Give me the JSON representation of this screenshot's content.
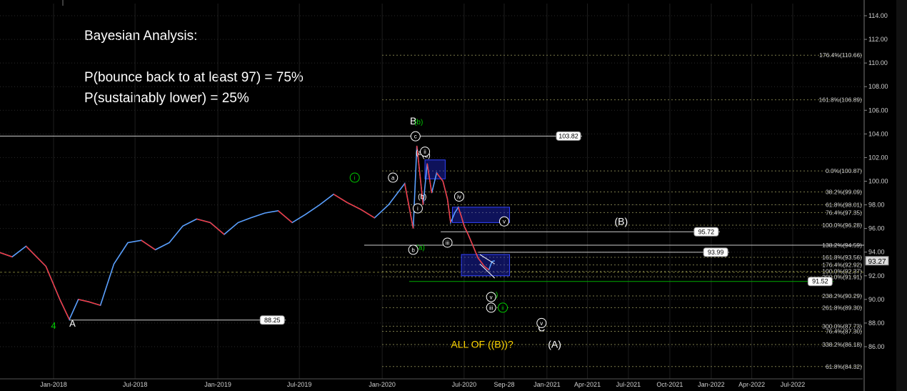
{
  "annotations": {
    "title": "Bayesian Analysis:",
    "prob_bounce": "P(bounce back to at least 97) = 75%",
    "prob_lower": "P(sustainably lower) = 25%"
  },
  "chart_data": {
    "type": "line",
    "title": "",
    "xlabel": "",
    "ylabel": "",
    "ylim": [
      83.5,
      115
    ],
    "grid": true,
    "x_ticks": [
      "Jan-2018",
      "Jul-2018",
      "Jan-2019",
      "Jul-2019",
      "Jan-2020",
      "Jul-2020",
      "Sep-28",
      "Jan-2021",
      "Apr-2021",
      "Jul-2021",
      "Oct-2021",
      "Jan-2022",
      "Apr-2022",
      "Jul-2022"
    ],
    "y_ticks": [
      86.0,
      88.0,
      90.0,
      92.0,
      94.0,
      96.0,
      98.0,
      100.0,
      102.0,
      104.0,
      106.0,
      108.0,
      110.0,
      112.0,
      114.0
    ],
    "last_price": 93.27,
    "price_path": [
      [
        "2017-09-01",
        94.0
      ],
      [
        "2017-10-01",
        93.6
      ],
      [
        "2017-11-01",
        94.5
      ],
      [
        "2017-12-15",
        92.8
      ],
      [
        "2018-01-15",
        90.0
      ],
      [
        "2018-02-05",
        88.3
      ],
      [
        "2018-02-25",
        90.0
      ],
      [
        "2018-03-20",
        89.8
      ],
      [
        "2018-04-15",
        89.5
      ],
      [
        "2018-05-15",
        93.0
      ],
      [
        "2018-06-15",
        94.8
      ],
      [
        "2018-07-15",
        95.0
      ],
      [
        "2018-08-15",
        94.2
      ],
      [
        "2018-09-15",
        94.8
      ],
      [
        "2018-10-15",
        96.2
      ],
      [
        "2018-11-15",
        96.8
      ],
      [
        "2018-12-15",
        96.5
      ],
      [
        "2019-01-15",
        95.5
      ],
      [
        "2019-02-15",
        96.5
      ],
      [
        "2019-03-15",
        96.9
      ],
      [
        "2019-04-15",
        97.3
      ],
      [
        "2019-05-15",
        97.5
      ],
      [
        "2019-06-15",
        96.5
      ],
      [
        "2019-07-15",
        97.2
      ],
      [
        "2019-08-15",
        98.0
      ],
      [
        "2019-09-15",
        98.9
      ],
      [
        "2019-10-15",
        98.2
      ],
      [
        "2019-11-15",
        97.6
      ],
      [
        "2019-12-15",
        96.9
      ],
      [
        "2020-01-15",
        98.0
      ],
      [
        "2020-02-20",
        99.8
      ],
      [
        "2020-03-10",
        96.0
      ],
      [
        "2020-03-18",
        103.0
      ],
      [
        "2020-03-25",
        100.5
      ],
      [
        "2020-04-01",
        98.0
      ],
      [
        "2020-04-10",
        101.5
      ],
      [
        "2020-04-20",
        99.0
      ],
      [
        "2020-05-01",
        100.7
      ],
      [
        "2020-05-15",
        100.0
      ],
      [
        "2020-05-25",
        98.5
      ],
      [
        "2020-06-01",
        96.5
      ],
      [
        "2020-06-10",
        97.3
      ],
      [
        "2020-06-18",
        97.8
      ],
      [
        "2020-06-25",
        97.0
      ],
      [
        "2020-07-01",
        96.2
      ],
      [
        "2020-07-10",
        95.5
      ],
      [
        "2020-07-20",
        94.6
      ],
      [
        "2020-08-01",
        93.5
      ],
      [
        "2020-08-15",
        92.8
      ],
      [
        "2020-08-25",
        92.5
      ],
      [
        "2020-09-01",
        93.2
      ],
      [
        "2020-09-07",
        93.27
      ]
    ],
    "horizontal_levels": [
      {
        "label": "103.82",
        "y": 103.82,
        "from": "2017-08-01",
        "to": "2021-03-20"
      },
      {
        "label": "95.72",
        "y": 95.72,
        "from": "2020-05-10",
        "to": "2022-01-20"
      },
      {
        "label": "93.99",
        "y": 93.99,
        "from": "2020-08-01",
        "to": "2022-02-10"
      },
      {
        "label": "91.52",
        "y": 91.52,
        "from": "2020-03-01",
        "to": "2022-09-30"
      },
      {
        "label": "88.25",
        "y": 88.25,
        "from": "2018-02-05",
        "to": "2019-06-01"
      }
    ],
    "fib_levels": [
      {
        "label": "176.4%(110.66)",
        "y": 110.66
      },
      {
        "label": "161.8%(106.89)",
        "y": 106.89
      },
      {
        "label": "0.0%(100.87)",
        "y": 100.87
      },
      {
        "label": "38.2%(99.09)",
        "y": 99.09
      },
      {
        "label": "61.8%(98.01)",
        "y": 98.01
      },
      {
        "label": "76.4%(97.35)",
        "y": 97.35
      },
      {
        "label": "100.0%(96.28)",
        "y": 96.28
      },
      {
        "label": "138.2%(94.59)",
        "y": 94.59
      },
      {
        "label": "161.8%(93.56)",
        "y": 93.56
      },
      {
        "label": "176.4%(92.92)",
        "y": 92.92
      },
      {
        "label": "100.0%(92.37)",
        "y": 92.37
      },
      {
        "label": "200.0%(91.91)",
        "y": 91.91
      },
      {
        "label": "238.2%(90.29)",
        "y": 90.29
      },
      {
        "label": "261.8%(89.30)",
        "y": 89.3
      },
      {
        "label": "300.0%(87.73)",
        "y": 87.73
      },
      {
        "label": "76.4%(87.30)",
        "y": 87.3
      },
      {
        "label": "338.2%(86.18)",
        "y": 86.18
      },
      {
        "label": "61.8%(84.32)",
        "y": 84.32
      }
    ],
    "wave_labels": [
      {
        "text": "4",
        "date": "2018-01-01",
        "y": 87.5,
        "color": "#00cc00",
        "size": 13
      },
      {
        "text": "A",
        "date": "2018-02-12",
        "y": 87.7,
        "color": "#ffffff",
        "size": 13
      },
      {
        "text": "B",
        "date": "2020-03-10",
        "y": 104.8,
        "color": "#ffffff",
        "size": 14
      },
      {
        "text": "(b)",
        "date": "2020-03-22",
        "y": 104.8,
        "color": "#00cc00",
        "size": 10
      },
      {
        "text": "(a)",
        "date": "2020-03-25",
        "y": 102.2,
        "color": "#ffffff",
        "size": 10
      },
      {
        "text": "(c)",
        "date": "2020-04-08",
        "y": 102.0,
        "color": "#ffffff",
        "size": 10
      },
      {
        "text": "(b)",
        "date": "2020-03-30",
        "y": 98.5,
        "color": "#ffffff",
        "size": 10
      },
      {
        "text": "(a)",
        "date": "2020-03-26",
        "y": 94.2,
        "color": "#00cc00",
        "size": 10
      },
      {
        "text": "(c)",
        "date": "2020-09-05",
        "y": 90.2,
        "color": "#00cc00",
        "size": 10
      },
      {
        "text": "(B)",
        "date": "2021-06-15",
        "y": 96.3,
        "color": "#ffffff",
        "size": 14
      },
      {
        "text": "C",
        "date": "2020-12-20",
        "y": 87.3,
        "color": "#ffffff",
        "size": 14
      },
      {
        "text": "ALL OF ((B))?",
        "date": "2020-08-10",
        "y": 85.9,
        "color": "#ffd700",
        "size": 14
      },
      {
        "text": "(A)",
        "date": "2021-01-18",
        "y": 85.9,
        "color": "#ffffff",
        "size": 14
      }
    ],
    "circled_labels": [
      {
        "text": "i",
        "date": "2019-11-01",
        "y": 100.3,
        "color": "#00cc00"
      },
      {
        "text": "a",
        "date": "2020-01-25",
        "y": 100.3,
        "color": "#ffffff"
      },
      {
        "text": "c",
        "date": "2020-03-15",
        "y": 103.8,
        "color": "#ffffff"
      },
      {
        "text": "ii",
        "date": "2020-04-05",
        "y": 102.5,
        "color": "#ffffff"
      },
      {
        "text": "i",
        "date": "2020-03-20",
        "y": 97.7,
        "color": "#ffffff"
      },
      {
        "text": "b",
        "date": "2020-03-10",
        "y": 94.2,
        "color": "#ffffff"
      },
      {
        "text": "iv",
        "date": "2020-06-20",
        "y": 98.7,
        "color": "#ffffff"
      },
      {
        "text": "iii",
        "date": "2020-05-25",
        "y": 94.8,
        "color": "#ffffff"
      },
      {
        "text": "v",
        "date": "2020-09-28",
        "y": 96.6,
        "color": "#ffffff"
      },
      {
        "text": "v",
        "date": "2020-08-30",
        "y": 90.2,
        "color": "#ffffff"
      },
      {
        "text": "iii",
        "date": "2020-08-30",
        "y": 89.3,
        "color": "#ffffff"
      },
      {
        "text": "ii",
        "date": "2020-09-25",
        "y": 89.3,
        "color": "#00cc00"
      },
      {
        "text": "v",
        "date": "2020-12-20",
        "y": 88.0,
        "color": "#ffffff"
      }
    ],
    "boxes": [
      {
        "from": "2020-04-05",
        "to": "2020-05-20",
        "y_low": 100.2,
        "y_high": 101.8
      },
      {
        "from": "2020-06-05",
        "to": "2020-10-10",
        "y_low": 96.5,
        "y_high": 97.8
      },
      {
        "from": "2020-06-25",
        "to": "2020-10-10",
        "y_low": 92.0,
        "y_high": 93.8
      }
    ],
    "channel": [
      {
        "from": [
          "2020-08-05",
          93.8
        ],
        "to": [
          "2020-09-07",
          93.0
        ]
      },
      {
        "from": [
          "2020-08-05",
          93.0
        ],
        "to": [
          "2020-09-07",
          91.8
        ]
      }
    ]
  }
}
